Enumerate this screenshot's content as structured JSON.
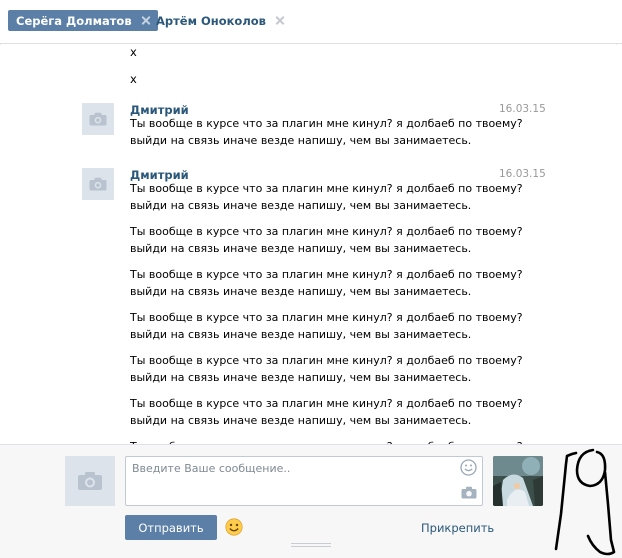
{
  "tabs": [
    {
      "label": "Серёга Долматов",
      "active": true
    },
    {
      "label": "Артём Оноколов",
      "active": false
    }
  ],
  "tail_lines": [
    "x",
    "x"
  ],
  "messages": [
    {
      "author": "Дмитрий",
      "date": "16.03.15",
      "lines": [
        "Ты вообще в курсе что за плагин мне кинул? я долбаеб по твоему?",
        "выйди на связь иначе везде напишу, чем вы занимаетесь."
      ]
    },
    {
      "author": "Дмитрий",
      "date": "16.03.15",
      "lines": [
        "Ты вообще в курсе что за плагин мне кинул? я долбаеб по твоему?",
        "выйди на связь иначе везде напишу, чем вы занимаетесь.",
        "Ты вообще в курсе что за плагин мне кинул? я долбаеб по твоему?",
        "выйди на связь иначе везде напишу, чем вы занимаетесь.",
        "Ты вообще в курсе что за плагин мне кинул? я долбаеб по твоему?",
        "выйди на связь иначе везде напишу, чем вы занимаетесь.",
        "Ты вообще в курсе что за плагин мне кинул? я долбаеб по твоему?",
        "выйди на связь иначе везде напишу, чем вы занимаетесь.",
        "Ты вообще в курсе что за плагин мне кинул? я долбаеб по твоему?",
        "выйди на связь иначе везде напишу, чем вы занимаетесь.",
        "Ты вообще в курсе что за плагин мне кинул? я долбаеб по твоему?",
        "выйди на связь иначе везде напишу, чем вы занимаетесь.",
        "Ты вообще в курсе что за плагин мне кинул? я долбаеб по твоему?"
      ]
    }
  ],
  "composer": {
    "placeholder": "Введите Ваше сообщение..",
    "send_label": "Отправить",
    "attach_label": "Прикрепить"
  },
  "icons": {
    "avatar": "camera-icon",
    "smile": "smile-icon",
    "emoji": "emoji-icon"
  },
  "colors": {
    "accent": "#5b7fa6",
    "link": "#2b587a",
    "date": "#999999",
    "avatar_bg": "#dde3ea"
  },
  "annotation": "19"
}
